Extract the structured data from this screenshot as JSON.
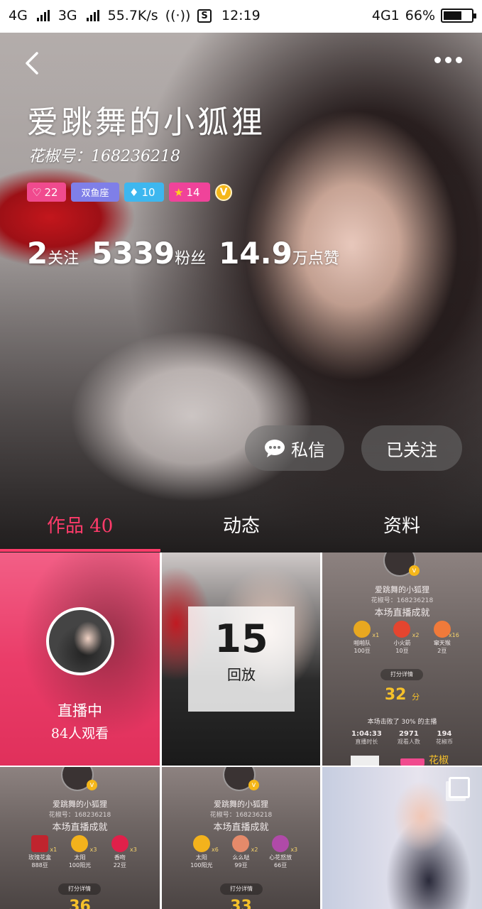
{
  "status_bar": {
    "net1": "4G",
    "net2": "3G",
    "speed": "55.7K/s",
    "time": "12:19",
    "net3": "4G1",
    "battery": "66%",
    "battery_level": 0.66
  },
  "profile": {
    "name": "爱跳舞的小狐狸",
    "id_line": "花椒号：168236218",
    "badges": {
      "fans": "22",
      "zodiac": "双鱼座",
      "diamond": "10",
      "level": "14",
      "vip": "V"
    },
    "stats": {
      "following_num": "2",
      "following_label": "关注",
      "fans_num": "5339",
      "fans_label": "粉丝",
      "likes_num": "14.9",
      "likes_label": "万点赞"
    }
  },
  "actions": {
    "message": "私信",
    "follow": "已关注"
  },
  "tabs": [
    {
      "label": "作品 40"
    },
    {
      "label": "动态"
    },
    {
      "label": "资料"
    }
  ],
  "grid": {
    "live": {
      "status": "直播中",
      "viewers": "84人观看"
    },
    "replay": {
      "count": "15",
      "label": "回放"
    },
    "card1": {
      "name": "爱跳舞的小狐狸",
      "id": "花椒号：168236218",
      "title": "本场直播成就",
      "gifts": [
        {
          "name": "啪啪队",
          "price": "100豆",
          "count": "x1"
        },
        {
          "name": "小火箭",
          "price": "10豆",
          "count": "x2"
        },
        {
          "name": "窜天猴",
          "price": "2豆",
          "count": "x16"
        }
      ],
      "detail": "打分详情",
      "score": "32",
      "score_unit": "分",
      "beat": "本场击败了 30% 的主播",
      "metrics": [
        {
          "value": "1:04:33",
          "label": "直播时长"
        },
        {
          "value": "2971",
          "label": "观看人数"
        },
        {
          "value": "194",
          "label": "花椒币"
        }
      ],
      "brand": "花椒"
    },
    "card2": {
      "name": "爱跳舞的小狐狸",
      "id": "花椒号：168236218",
      "title": "本场直播成就",
      "gifts": [
        {
          "name": "玫瑰花盒",
          "price": "888豆",
          "count": "x1"
        },
        {
          "name": "太阳",
          "price": "100阳光",
          "count": "x3"
        },
        {
          "name": "香吻",
          "price": "22豆",
          "count": "x3"
        }
      ],
      "detail": "打分详情",
      "score": "36"
    },
    "card3": {
      "name": "爱跳舞的小狐狸",
      "id": "花椒号：168236218",
      "title": "本场直播成就",
      "gifts": [
        {
          "name": "太阳",
          "price": "100阳光",
          "count": "x6"
        },
        {
          "name": "么么哒",
          "price": "99豆",
          "count": "x2"
        },
        {
          "name": "心花怒放",
          "price": "66豆",
          "count": "x3"
        }
      ],
      "detail": "打分详情",
      "score": "33"
    }
  },
  "colors": {
    "accent": "#ff3b6a",
    "live_bg": "#ea3d69",
    "score": "#f6c12a"
  }
}
